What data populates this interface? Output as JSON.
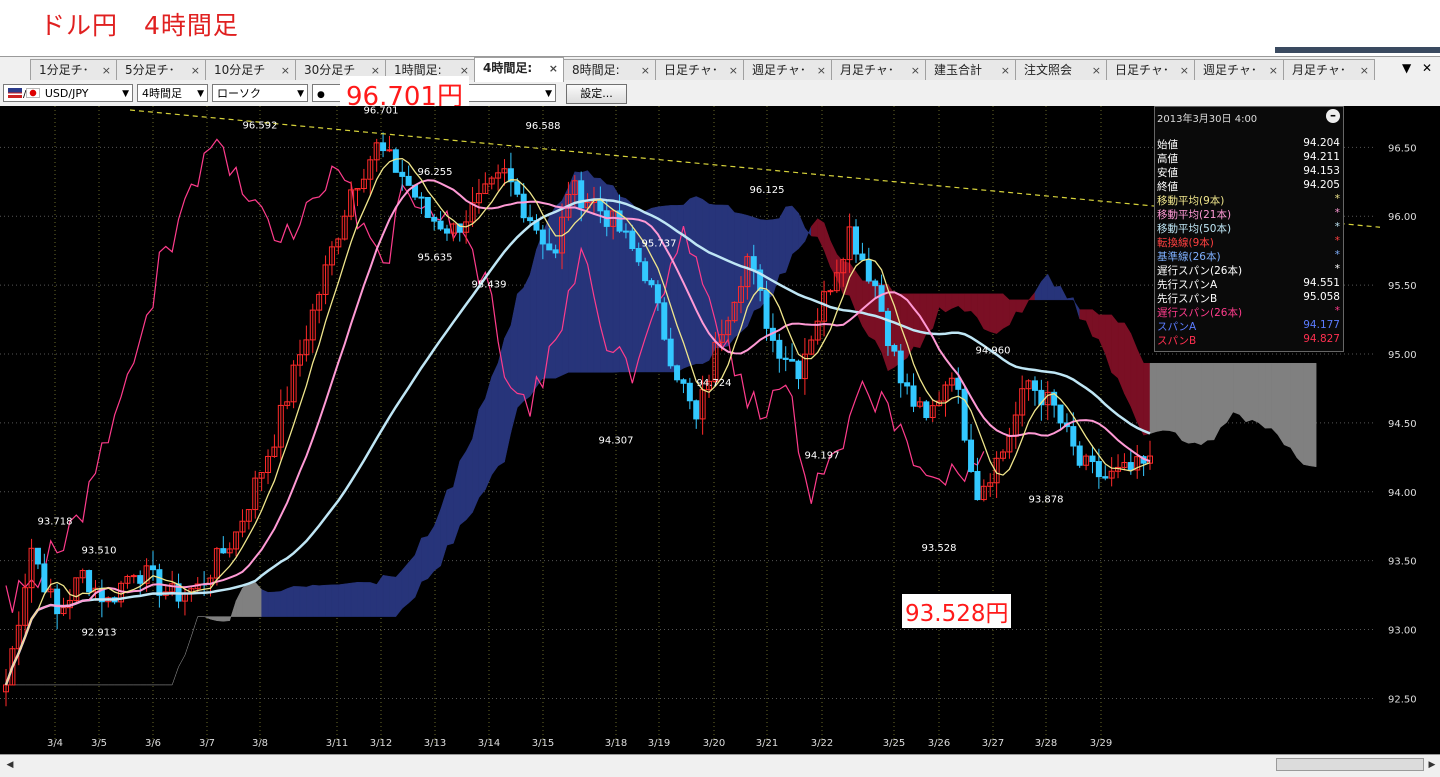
{
  "page_title": "ドル円　4時間足",
  "tabs": [
    {
      "label": "1分足チ･",
      "active": false
    },
    {
      "label": "5分足チ･",
      "active": false
    },
    {
      "label": "10分足チ",
      "active": false
    },
    {
      "label": "30分足チ",
      "active": false
    },
    {
      "label": "1時間足:",
      "active": false
    },
    {
      "label": "4時間足:",
      "active": true
    },
    {
      "label": "8時間足:",
      "active": false
    },
    {
      "label": "日足チャ･",
      "active": false
    },
    {
      "label": "週足チャ･",
      "active": false
    },
    {
      "label": "月足チャ･",
      "active": false
    },
    {
      "label": "建玉合計",
      "active": false
    },
    {
      "label": "注文照会",
      "active": false
    },
    {
      "label": "日足チャ･",
      "active": false
    },
    {
      "label": "週足チャ･",
      "active": false
    },
    {
      "label": "月足チャ･",
      "active": false
    }
  ],
  "tab_close_glyph": "×",
  "tab_controls": {
    "menu": "▼",
    "close": "✕"
  },
  "toolbar": {
    "pair": "USD/JPY",
    "timeframe": "4時間足",
    "chart_type": "ローソク",
    "settings_button": "設定..."
  },
  "highlight_high": "96.701円",
  "highlight_low": "93.528円",
  "info_panel": {
    "header": "2013年3月30日  4:00",
    "rows": [
      {
        "label": "始値",
        "value": "94.204",
        "color": "#ffffff"
      },
      {
        "label": "高値",
        "value": "94.211",
        "color": "#ffffff"
      },
      {
        "label": "安値",
        "value": "94.153",
        "color": "#ffffff"
      },
      {
        "label": "終値",
        "value": "94.205",
        "color": "#ffffff"
      },
      {
        "label": "移動平均(9本)",
        "value": "*",
        "color": "#f0e68c"
      },
      {
        "label": "移動平均(21本)",
        "value": "*",
        "color": "#ff9ad5"
      },
      {
        "label": "移動平均(50本)",
        "value": "*",
        "color": "#bfe6f5"
      },
      {
        "label": "転換線(9本)",
        "value": "*",
        "color": "#ff4040"
      },
      {
        "label": "基準線(26本)",
        "value": "*",
        "color": "#7fb0ff"
      },
      {
        "label": "遅行スパン(26本)",
        "value": "*",
        "color": "#ffffff"
      },
      {
        "label": "先行スパンA",
        "value": "94.551",
        "color": "#ffffff"
      },
      {
        "label": "先行スパンB",
        "value": "95.058",
        "color": "#ffffff"
      },
      {
        "label": "遅行スパン(26本)",
        "value": "*",
        "color": "#ff3c8c"
      },
      {
        "label": "スパンA",
        "value": "94.177",
        "color": "#5b7cff"
      },
      {
        "label": "スパンB",
        "value": "94.827",
        "color": "#ff3050"
      }
    ]
  },
  "chart_data": {
    "type": "candlestick",
    "instrument": "USD/JPY",
    "timeframe": "4時間足",
    "y_range": [
      92.3,
      96.8
    ],
    "y_ticks": [
      "96.50",
      "96.00",
      "95.50",
      "95.00",
      "94.50",
      "94.00",
      "93.50",
      "93.00",
      "92.50"
    ],
    "x_ticks": [
      "3/4",
      "3/5",
      "3/6",
      "3/7",
      "3/8",
      "3/11",
      "3/12",
      "3/13",
      "3/14",
      "3/15",
      "3/18",
      "3/19",
      "3/20",
      "3/21",
      "3/22",
      "3/25",
      "3/26",
      "3/27",
      "3/28",
      "3/29"
    ],
    "annotations": [
      {
        "text": "93.718",
        "x": "3/4",
        "value": 93.718
      },
      {
        "text": "93.510",
        "x": "3/5",
        "value": 93.51
      },
      {
        "text": "92.913",
        "x": "3/5",
        "value": 92.913
      },
      {
        "text": "96.592",
        "x": "3/8",
        "value": 96.592
      },
      {
        "text": "96.701",
        "x": "3/12",
        "value": 96.701
      },
      {
        "text": "95.635",
        "x": "3/13",
        "value": 95.635
      },
      {
        "text": "96.255",
        "x": "3/13",
        "value": 96.255
      },
      {
        "text": "95.439",
        "x": "3/14",
        "value": 95.439
      },
      {
        "text": "96.588",
        "x": "3/15",
        "value": 96.588
      },
      {
        "text": "94.307",
        "x": "3/18",
        "value": 94.307
      },
      {
        "text": "95.737",
        "x": "3/19",
        "value": 95.737
      },
      {
        "text": "94.724",
        "x": "3/20",
        "value": 94.724
      },
      {
        "text": "96.125",
        "x": "3/21",
        "value": 96.125
      },
      {
        "text": "94.197",
        "x": "3/22",
        "value": 94.197
      },
      {
        "text": "93.528",
        "x": "3/26",
        "value": 93.528
      },
      {
        "text": "94.960",
        "x": "3/27",
        "value": 94.96
      },
      {
        "text": "93.878",
        "x": "3/28",
        "value": 93.878
      }
    ],
    "series_colors": {
      "up": "#ff2a2a",
      "down": "#33c8ff",
      "ma9": "#f0e68c",
      "ma21": "#ff9ad5",
      "ma50": "#bfe6f5",
      "chikou": "#ff3c8c",
      "cloud_bull": "#27347a",
      "cloud_bear": "#7a0f24",
      "cloud_future": "#808080",
      "trendline": "#d6d23a"
    }
  }
}
